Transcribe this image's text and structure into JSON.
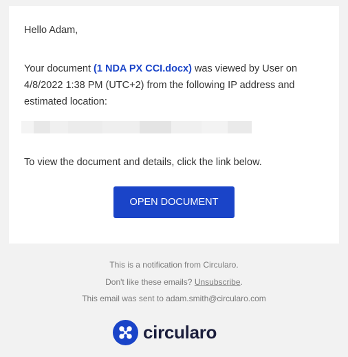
{
  "email": {
    "greeting": "Hello Adam,",
    "body_before": "Your document ",
    "document_name": "(1 NDA PX CCI.docx)",
    "body_after": " was viewed by User on 4/8/2022 1:38 PM (UTC+2) from the following IP address and estimated location:",
    "instruction": "To view the document and details, click the link below.",
    "button_label": "OPEN DOCUMENT"
  },
  "footer": {
    "notification": "This is a notification from Circularo.",
    "unsubscribe_prefix": "Don't like these emails? ",
    "unsubscribe_label": "Unsubscribe",
    "unsubscribe_suffix": ".",
    "sent_to": "This email was sent to adam.smith@circularo.com"
  },
  "brand": {
    "name": "circularo",
    "icon": "circularo-logo-icon"
  },
  "colors": {
    "accent": "#1a44c8",
    "brand_dark": "#1b1e3c",
    "page_bg": "#f2f2f2",
    "card_bg": "#ffffff",
    "body_text": "#333333",
    "footer_text": "#7a7a7a"
  }
}
